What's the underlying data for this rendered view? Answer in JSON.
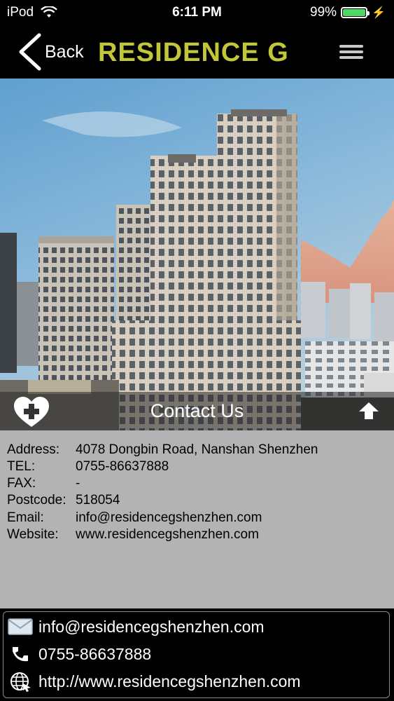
{
  "status_bar": {
    "carrier": "iPod",
    "time": "6:11 PM",
    "battery_percent": "99%",
    "battery_level": 0.99,
    "wifi_icon": "wifi-icon",
    "charging_icon": "bolt-icon"
  },
  "nav": {
    "back_label": "Back",
    "title": "RESIDENCE G",
    "title_color": "#c2c639",
    "back_icon": "chevron-left-icon",
    "menu_icon": "hamburger-menu-icon"
  },
  "hero": {
    "image": "residence-g-building-photo",
    "contact_title": "Contact Us",
    "favorite_icon": "heart-plus-icon",
    "up_icon": "up-arrow-icon"
  },
  "info": {
    "rows": [
      {
        "label": "Address:",
        "value": "4078 Dongbin Road, Nanshan Shenzhen"
      },
      {
        "label": "TEL:",
        "value": "0755-86637888"
      },
      {
        "label": "FAX:",
        "value": "-"
      },
      {
        "label": "Postcode:",
        "value": "518054"
      },
      {
        "label": "Email:",
        "value": "info@residencegshenzhen.com"
      },
      {
        "label": "Website:",
        "value": "www.residencegshenzhen.com"
      }
    ]
  },
  "quick_contact": {
    "email": {
      "icon": "envelope-icon",
      "text": "info@residencegshenzhen.com"
    },
    "phone": {
      "icon": "phone-icon",
      "text": "0755-86637888"
    },
    "web": {
      "icon": "globe-icon",
      "text": "http://www.residencegshenzhen.com"
    }
  },
  "colors": {
    "background": "#000000",
    "info_background": "#b3b3b3",
    "battery_green": "#4cd964"
  }
}
